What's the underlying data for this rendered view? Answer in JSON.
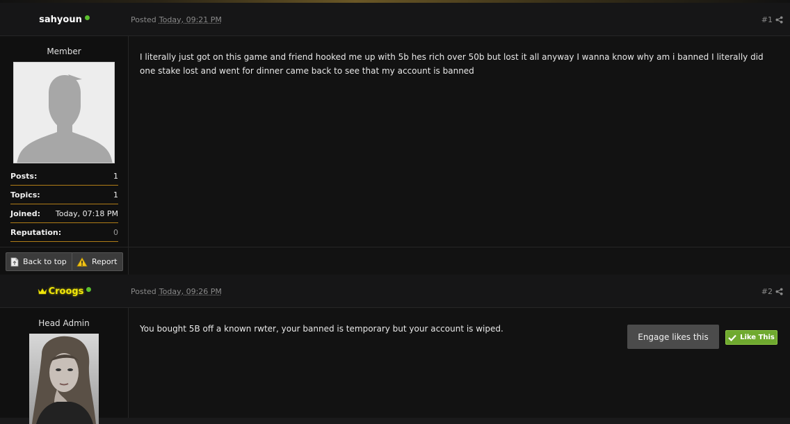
{
  "posts": [
    {
      "author": "sahyoun",
      "posted_prefix": "Posted",
      "posted_date": "Today, 09:21 PM",
      "post_number": "#1",
      "group": "Member",
      "stats": [
        {
          "label": "Posts:",
          "value": "1"
        },
        {
          "label": "Topics:",
          "value": "1"
        },
        {
          "label": "Joined:",
          "value": "Today, 07:18 PM"
        },
        {
          "label": "Reputation:",
          "value": "0"
        }
      ],
      "content": "I literally just got on this game and friend hooked me up with 5b hes rich over 50b but lost it all anyway I wanna know why am i banned I literally did one stake lost and went for dinner came back to see that my account is banned",
      "actions": {
        "back_to_top": "Back to top",
        "report": "Report"
      }
    },
    {
      "author": "Croogs",
      "posted_prefix": "Posted",
      "posted_date": "Today, 09:26 PM",
      "post_number": "#2",
      "group": "Head Admin",
      "content": "You bought 5B off a known rwter, your banned is temporary but your account is wiped.",
      "engage_text": "Engage likes this",
      "like_label": "Like This"
    }
  ],
  "colors": {
    "accent_gold": "#b07d17",
    "admin_name": "#f1e60b",
    "online": "#5bbf2e",
    "like_green": "#6fa92f"
  }
}
